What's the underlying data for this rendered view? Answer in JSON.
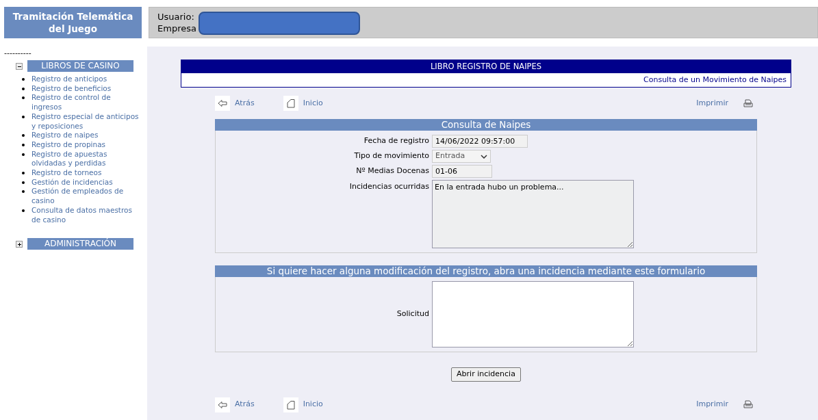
{
  "header": {
    "title": "Tramitación Telemática del Juego",
    "user_label": "Usuario:",
    "company_label": "Empresa"
  },
  "sidebar": {
    "separator": "----------",
    "groups": [
      {
        "label": "LIBROS DE CASINO",
        "expanded": true,
        "items": [
          "Registro de anticipos",
          "Registro de beneficios",
          "Registro de control de ingresos",
          "Registro especial de anticipos y reposiciones",
          "Registro de naipes",
          "Registro de propinas",
          "Registro de apuestas olvidadas y perdidas",
          "Registro de torneos",
          "Gestión de incidencias",
          "Gestión de empleados de casino",
          "Consulta de datos maestros de casino"
        ]
      },
      {
        "label": "ADMINISTRACIÓN",
        "expanded": false
      }
    ]
  },
  "banner": {
    "title": "LIBRO REGISTRO DE NAIPES",
    "subtitle": "Consulta de un Movimiento de Naipes"
  },
  "nav_top": {
    "back": "Atrás",
    "home": "Inicio",
    "print": "Imprimir"
  },
  "consulta": {
    "title": "Consulta de Naipes",
    "fields": [
      {
        "kind": "text",
        "label": "Fecha de registro",
        "value": "14/06/2022 09:57:00"
      },
      {
        "kind": "select",
        "label": "Tipo de movimiento",
        "value": "Entrada"
      },
      {
        "kind": "short",
        "label": "Nº Medias Docenas",
        "value": "01-06"
      },
      {
        "kind": "textarea",
        "label": "Incidencias ocurridas",
        "value": "En la entrada hubo un problema..."
      }
    ]
  },
  "solicitud": {
    "title": "Si quiere hacer alguna modificación del registro, abra una incidencia mediante este formulario",
    "fields": [
      {
        "kind": "textarea",
        "label": "Solicitud"
      }
    ],
    "button": "Abrir incidencia"
  },
  "nav_bottom": {
    "back": "Atrás",
    "home": "Inicio",
    "print": "Imprimir"
  }
}
